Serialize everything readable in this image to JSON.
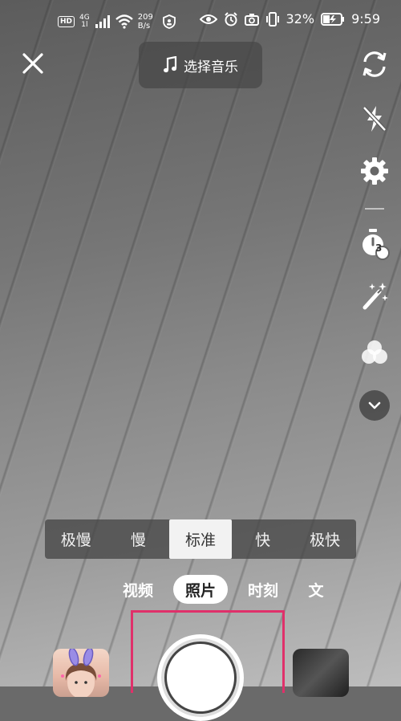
{
  "status_bar": {
    "hd": "HD",
    "network": "4G",
    "network_sub": "1l",
    "speed_value": "209",
    "speed_unit": "B/s",
    "battery": "32%",
    "time": "9:59"
  },
  "top": {
    "music_label": "选择音乐"
  },
  "right_rail": [
    {
      "icon": "flip-camera-icon"
    },
    {
      "icon": "flash-off-icon"
    },
    {
      "icon": "settings-icon"
    },
    {
      "icon": "timer-icon",
      "badge": "3"
    },
    {
      "icon": "beauty-wand-icon"
    },
    {
      "icon": "filter-icon"
    },
    {
      "icon": "more-chevron-icon"
    }
  ],
  "speed_options": [
    "极慢",
    "慢",
    "标准",
    "快",
    "极快"
  ],
  "speed_selected": "标准",
  "modes": [
    "视频",
    "照片",
    "时刻",
    "文"
  ],
  "mode_selected": "照片",
  "colors": {
    "accent_frame": "#e0306a",
    "pill_bg": "#464646"
  }
}
